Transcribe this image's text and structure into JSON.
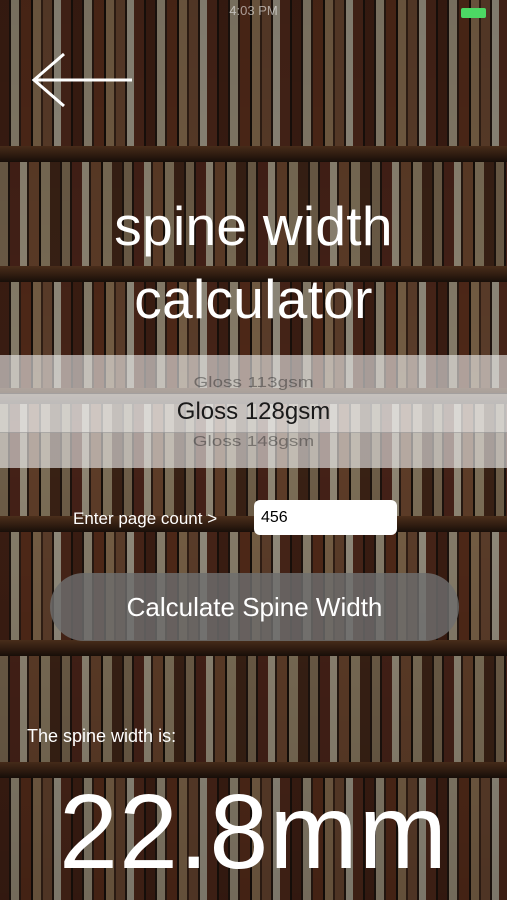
{
  "status_bar": {
    "time": "4:03 PM",
    "battery_color": "#4cd964"
  },
  "navigation": {
    "back_icon": "arrow-left-icon"
  },
  "title": {
    "line1": "spine width",
    "line2": "calculator"
  },
  "paper_picker": {
    "previous": "Gloss 113gsm",
    "selected": "Gloss 128gsm",
    "next": "Gloss 148gsm"
  },
  "page_count": {
    "label": "Enter page count >",
    "value": "456"
  },
  "calculate_button": {
    "label": "Calculate Spine Width"
  },
  "result": {
    "label": "The spine width is:",
    "value": "22.8mm"
  }
}
